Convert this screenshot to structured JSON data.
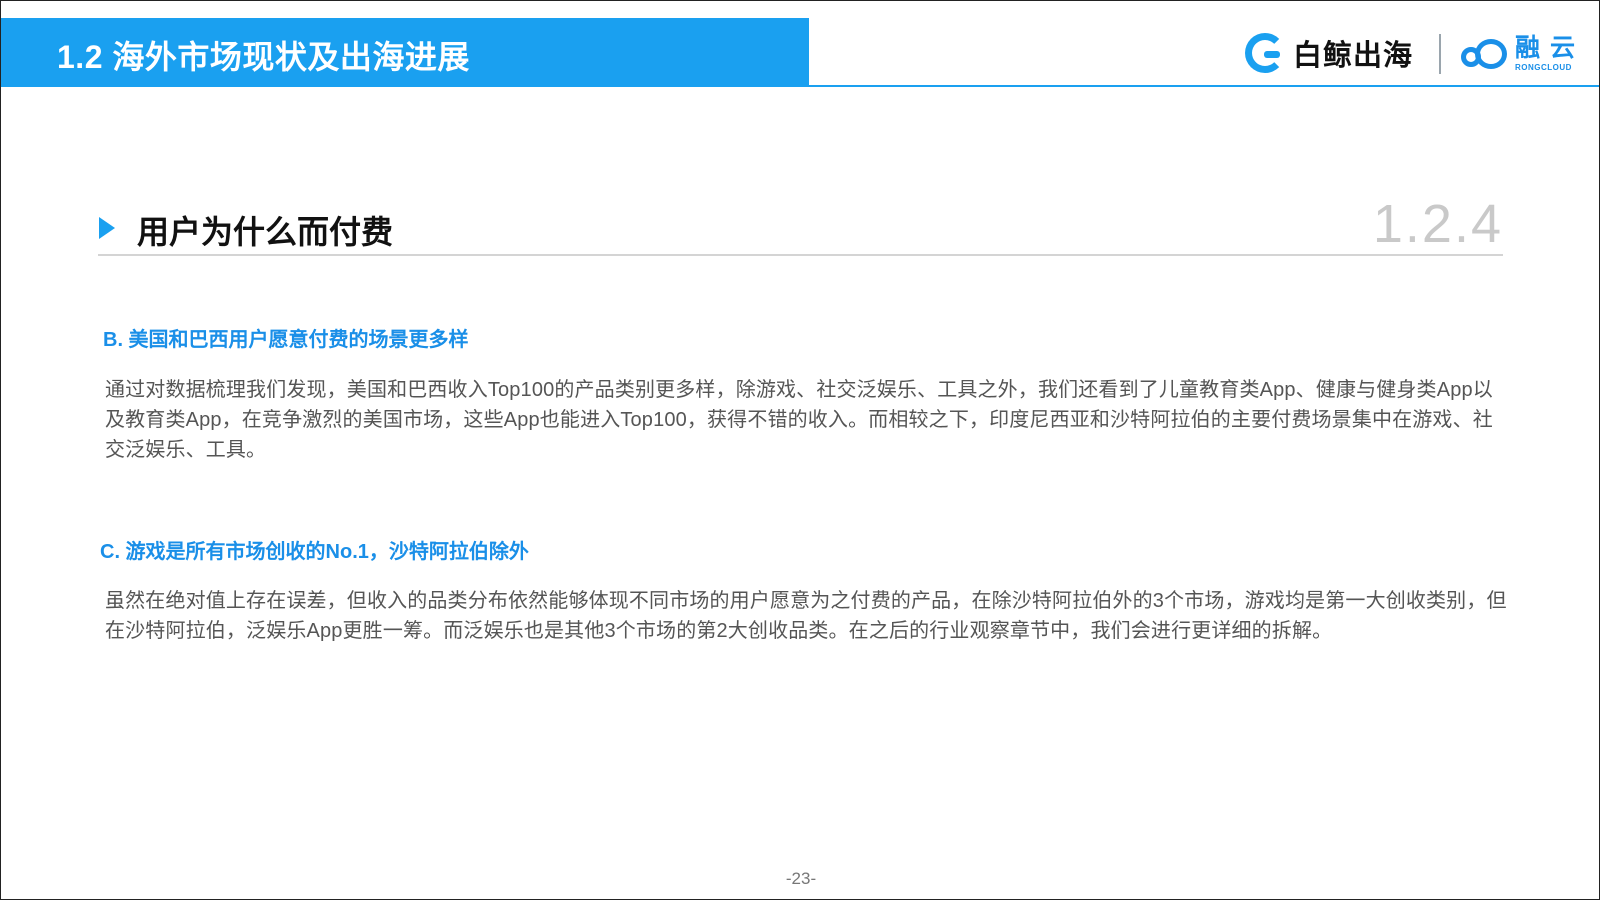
{
  "header": {
    "section_title": "1.2 海外市场现状及出海进展",
    "logo_left_text": "白鲸出海",
    "logo_right_cn": "融云",
    "logo_right_en": "RONGCLOUD",
    "accent_color": "#1aa0f0"
  },
  "subsection": {
    "title": "用户为什么而付费",
    "number": "1.2.4"
  },
  "blocks": [
    {
      "heading": "B. 美国和巴西用户愿意付费的场景更多样",
      "body": "通过对数据梳理我们发现，美国和巴西收入Top100的产品类别更多样，除游戏、社交泛娱乐、工具之外，我们还看到了儿童教育类App、健康与健身类App以及教育类App，在竞争激烈的美国市场，这些App也能进入Top100，获得不错的收入。而相较之下，印度尼西亚和沙特阿拉伯的主要付费场景集中在游戏、社交泛娱乐、工具。"
    },
    {
      "heading": "C. 游戏是所有市场创收的No.1，沙特阿拉伯除外",
      "body": "虽然在绝对值上存在误差，但收入的品类分布依然能够体现不同市场的用户愿意为之付费的产品，在除沙特阿拉伯外的3个市场，游戏均是第一大创收类别，但在沙特阿拉伯，泛娱乐App更胜一筹。而泛娱乐也是其他3个市场的第2大创收品类。在之后的行业观察章节中，我们会进行更详细的拆解。"
    }
  ],
  "footer": {
    "page_number": "-23-"
  }
}
